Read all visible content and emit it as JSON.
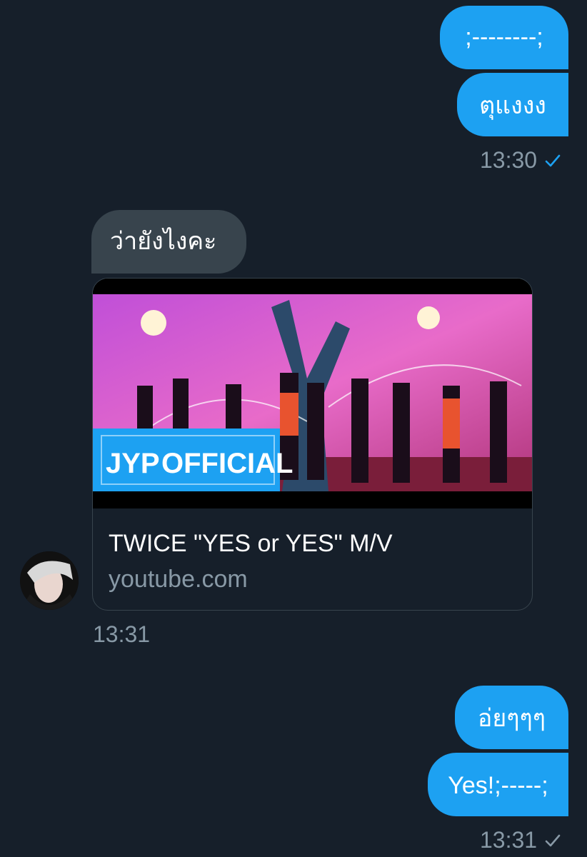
{
  "messages": {
    "m1": ";--------;",
    "m2": "ตุแงงง",
    "ts1": "13:30",
    "m3": "ว่ายังไงคะ",
    "card_title": "TWICE \"YES or YES\" M/V",
    "card_domain": "youtube.com",
    "ts2": "13:31",
    "m4": "อ่ยๆๆๆ",
    "m5": "Yes!;-----;",
    "ts3": "13:31"
  },
  "thumbnail": {
    "logo_text": "JYP",
    "badge_text": "OFFICIAL"
  },
  "colors": {
    "background": "#161f2a",
    "outgoing_bubble": "#1da1f2",
    "incoming_bubble": "#38444d",
    "timestamp": "#8899a6",
    "read_check": "#1da1f2",
    "sent_check": "#8899a6"
  }
}
